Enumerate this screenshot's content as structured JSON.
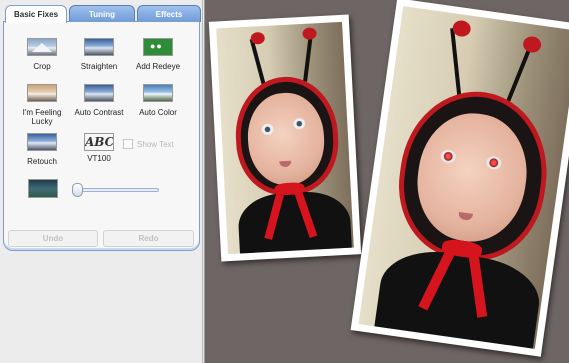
{
  "tabs": [
    {
      "label": "Basic Fixes",
      "active": true
    },
    {
      "label": "Tuning",
      "active": false
    },
    {
      "label": "Effects",
      "active": false
    }
  ],
  "tools": [
    {
      "label": "Crop",
      "icon": "crop-icon"
    },
    {
      "label": "Straighten",
      "icon": "straighten-icon"
    },
    {
      "label": "Add Redeye",
      "icon": "redeye-icon"
    },
    {
      "label": "I'm Feeling Lucky",
      "icon": "lucky-icon"
    },
    {
      "label": "Auto Contrast",
      "icon": "contrast-icon"
    },
    {
      "label": "Auto Color",
      "icon": "color-icon"
    },
    {
      "label": "Retouch",
      "icon": "retouch-icon"
    },
    {
      "label": "VT100",
      "icon": "vt100-icon"
    }
  ],
  "vt100_thumb_text": "ABC",
  "show_text": {
    "label": "Show Text",
    "checked": false,
    "enabled": false
  },
  "slider": {
    "value": 0.0
  },
  "buttons": {
    "undo": "Undo",
    "redo": "Redo"
  },
  "colors": {
    "tab_accent": "#6e9bd6",
    "canvas_bg": "#6e6664",
    "costume_red": "#c0181f"
  }
}
